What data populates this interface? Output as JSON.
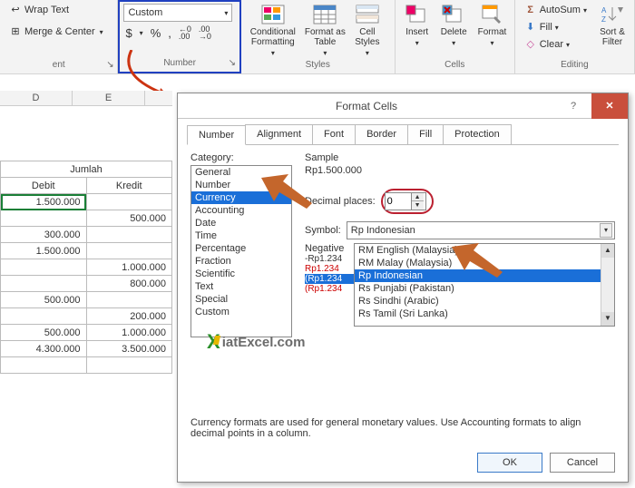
{
  "ribbon": {
    "alignment": {
      "wrap_text": "Wrap Text",
      "merge_center": "Merge & Center",
      "group_label": "ent"
    },
    "number": {
      "format_selected": "Custom",
      "group_label": "Number",
      "symbols": {
        "dollar": "$",
        "percent": "%",
        "comma": ",",
        "inc": "←0\n.00",
        "dec": ".00\n→0"
      }
    },
    "styles": {
      "cond": "Conditional\nFormatting",
      "table": "Format as\nTable",
      "cell": "Cell\nStyles",
      "group_label": "Styles"
    },
    "cells": {
      "insert": "Insert",
      "delete": "Delete",
      "format": "Format",
      "group_label": "Cells"
    },
    "editing": {
      "autosum": "AutoSum",
      "fill": "Fill",
      "clear": "Clear",
      "sort": "Sort &\nFilter",
      "group_label": "Editing"
    }
  },
  "sheet": {
    "cols": [
      "D",
      "E"
    ],
    "jumlah": "Jumlah",
    "debit": "Debit",
    "kredit": "Kredit",
    "rows": [
      {
        "d": "1.500.000",
        "k": ""
      },
      {
        "d": "",
        "k": "500.000"
      },
      {
        "d": "300.000",
        "k": ""
      },
      {
        "d": "1.500.000",
        "k": ""
      },
      {
        "d": "",
        "k": "1.000.000"
      },
      {
        "d": "",
        "k": "800.000"
      },
      {
        "d": "500.000",
        "k": ""
      },
      {
        "d": "",
        "k": "200.000"
      },
      {
        "d": "500.000",
        "k": "1.000.000"
      }
    ],
    "totals": {
      "d": "4.300.000",
      "k": "3.500.000"
    }
  },
  "dialog": {
    "title": "Format Cells",
    "tabs": [
      "Number",
      "Alignment",
      "Font",
      "Border",
      "Fill",
      "Protection"
    ],
    "category_label": "Category:",
    "categories": [
      "General",
      "Number",
      "Currency",
      "Accounting",
      "Date",
      "Time",
      "Percentage",
      "Fraction",
      "Scientific",
      "Text",
      "Special",
      "Custom"
    ],
    "selected_category": "Currency",
    "sample_label": "Sample",
    "sample_value": "Rp1.500.000",
    "decimal_label": "Decimal places:",
    "decimal_value": "0",
    "symbol_label": "Symbol:",
    "symbol_value": "Rp Indonesian",
    "negative_label": "Negative",
    "neg_previews": [
      "-Rp1.234",
      "Rp1.234",
      "(Rp1.234",
      "(Rp1.234"
    ],
    "symbol_options": [
      "RM English (Malaysia)",
      "RM Malay (Malaysia)",
      "Rp Indonesian",
      "Rs Punjabi (Pakistan)",
      "Rs Sindhi (Arabic)",
      "Rs Tamil (Sri Lanka)"
    ],
    "selected_symbol_option": "Rp Indonesian",
    "description": "Currency formats are used for general monetary values.  Use Accounting formats to align decimal points in a column.",
    "ok": "OK",
    "cancel": "Cancel"
  },
  "watermark": "iatExcel.com"
}
